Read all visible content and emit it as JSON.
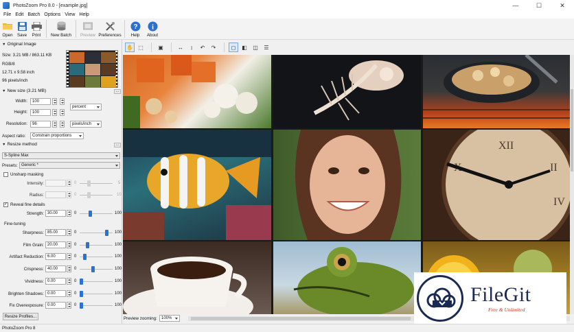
{
  "window": {
    "title": "PhotoZoom Pro 8.0 - [example.jpg]",
    "controls": [
      "—",
      "☐",
      "✕"
    ]
  },
  "menu": [
    "File",
    "Edit",
    "Batch",
    "Options",
    "View",
    "Help"
  ],
  "toolbar": {
    "open": "Open",
    "save": "Save",
    "print": "Print",
    "new_batch": "New Batch",
    "preview": "Preview",
    "preferences": "Preferences",
    "help": "Help",
    "about": "About"
  },
  "original_image": {
    "header": "Original Image",
    "size": "Size: 3.21 MB / 863.11 KB",
    "color": "RGB/8",
    "dimensions": "12.71 x 9.58 inch",
    "resolution": "96 pixels/inch"
  },
  "new_size": {
    "header": "New size (3.21 MB)",
    "width_label": "Width:",
    "width_value": "100",
    "height_label": "Height:",
    "height_value": "100",
    "unit": "percent",
    "resolution_label": "Resolution:",
    "resolution_value": "96",
    "resolution_unit": "pixels/inch",
    "aspect_label": "Aspect ratio:",
    "aspect_value": "Constrain proportions",
    "more": "..."
  },
  "resize_method": {
    "header": "Resize method",
    "method": "S-Spline Max",
    "presets_label": "Presets:",
    "preset_value": "Generic *",
    "more": "..."
  },
  "unsharp": {
    "label": "Unsharp masking",
    "intensity_label": "Intensity:",
    "intensity_min": "0",
    "intensity_max": "5",
    "radius_label": "Radius:",
    "radius_min": "0",
    "radius_max": "10"
  },
  "reveal": {
    "label": "Reveal fine details",
    "checked": "✓",
    "strength_label": "Strength:",
    "strength_value": "30.00",
    "strength_min": "0",
    "strength_max": "100",
    "strength_level": 0.3
  },
  "fine_tuning": {
    "header": "Fine-tuning",
    "rows": [
      {
        "label": "Sharpness:",
        "value": "85.00",
        "min": "0",
        "max": "100",
        "level": 0.85
      },
      {
        "label": "Film Grain:",
        "value": "20.00",
        "min": "0",
        "max": "100",
        "level": 0.2
      },
      {
        "label": "Artifact Reduction:",
        "value": "6.00",
        "min": "0",
        "max": "100",
        "level": 0.12
      },
      {
        "label": "Crispness:",
        "value": "40.00",
        "min": "0",
        "max": "100",
        "level": 0.4
      },
      {
        "label": "Vividness:",
        "value": "0.00",
        "min": "0",
        "max": "100",
        "level": 0.0
      },
      {
        "label": "Brighten Shadows:",
        "value": "0.00",
        "min": "0",
        "max": "100",
        "level": 0.0
      },
      {
        "label": "Fix Overexposure:",
        "value": "0.00",
        "min": "0",
        "max": "100",
        "level": 0.0
      }
    ]
  },
  "resize_profiles": "Resize Profiles...",
  "preview_zoom": {
    "label": "Preview zooming:",
    "value": "100%"
  },
  "status": "PhotoZoom Pro 8",
  "watermark": {
    "brand": "FileGit",
    "tagline": "Free & Unlimited"
  },
  "colors": {
    "accent": "#2a72d4",
    "brand": "#1b2a52",
    "tagline": "#d0392b"
  }
}
